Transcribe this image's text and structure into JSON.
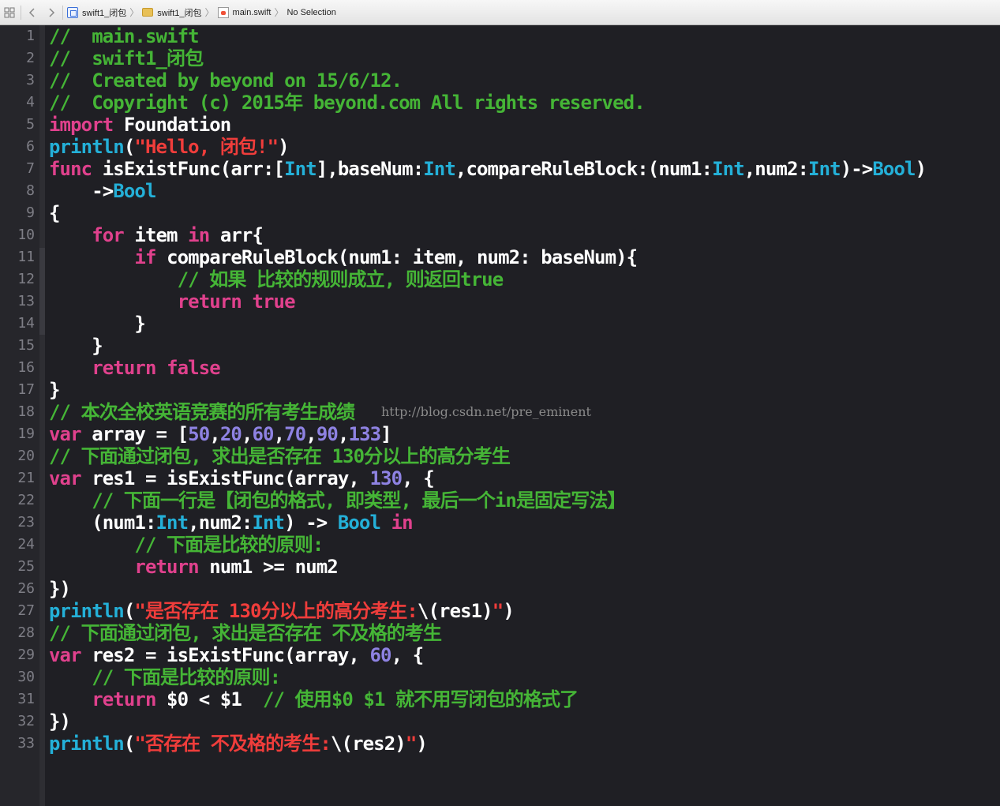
{
  "jumpbar": {
    "crumbs": [
      "swift1_闭包",
      "swift1_闭包",
      "main.swift",
      "No Selection"
    ]
  },
  "colors": {
    "background": "#1f1f24",
    "keyword": "#e0418d",
    "type": "#24b0d8",
    "string": "#f03d3b",
    "comment": "#45b536",
    "number": "#8e82e2",
    "plain": "#ffffff"
  },
  "watermark": "http://blog.csdn.net/pre_eminent",
  "gutter": [
    "1",
    "2",
    "3",
    "4",
    "5",
    "6",
    "7",
    "8",
    "9",
    "10",
    "11",
    "12",
    "13",
    "14",
    "15",
    "16",
    "17",
    "18",
    "19",
    "20",
    "21",
    "22",
    "23",
    "24",
    "25",
    "26",
    "27",
    "28",
    "29",
    "30",
    "31",
    "32",
    "33"
  ],
  "code": [
    [
      [
        "c",
        "//  main.swift"
      ]
    ],
    [
      [
        "c",
        "//  swift1_闭包"
      ]
    ],
    [
      [
        "c",
        "//  Created by beyond on 15/6/12."
      ]
    ],
    [
      [
        "c",
        "//  Copyright (c) 2015年 beyond.com All rights reserved."
      ]
    ],
    [
      [
        "k",
        "import"
      ],
      [
        "p",
        " Foundation"
      ]
    ],
    [
      [
        "t",
        "println"
      ],
      [
        "p",
        "("
      ],
      [
        "s",
        "\"Hello, 闭包!\""
      ],
      [
        "p",
        ")"
      ]
    ],
    [
      [
        "k",
        "func"
      ],
      [
        "p",
        " isExistFunc(arr:["
      ],
      [
        "t",
        "Int"
      ],
      [
        "p",
        "],baseNum:"
      ],
      [
        "t",
        "Int"
      ],
      [
        "p",
        ",compareRuleBlock:(num1:"
      ],
      [
        "t",
        "Int"
      ],
      [
        "p",
        ",num2:"
      ],
      [
        "t",
        "Int"
      ],
      [
        "p",
        ")->"
      ],
      [
        "t",
        "Bool"
      ],
      [
        "p",
        ")"
      ]
    ],
    [
      [
        "p",
        "    ->"
      ],
      [
        "t",
        "Bool"
      ]
    ],
    [
      [
        "p",
        "{"
      ]
    ],
    [
      [
        "p",
        "    "
      ],
      [
        "k",
        "for"
      ],
      [
        "p",
        " item "
      ],
      [
        "k",
        "in"
      ],
      [
        "p",
        " arr{"
      ]
    ],
    [
      [
        "p",
        "        "
      ],
      [
        "k",
        "if"
      ],
      [
        "p",
        " compareRuleBlock(num1: item, num2: baseNum){"
      ]
    ],
    [
      [
        "p",
        "            "
      ],
      [
        "c",
        "// 如果 比较的规则成立, 则返回true"
      ]
    ],
    [
      [
        "p",
        "            "
      ],
      [
        "k",
        "return"
      ],
      [
        "p",
        " "
      ],
      [
        "k",
        "true"
      ]
    ],
    [
      [
        "p",
        "        }"
      ]
    ],
    [
      [
        "p",
        "    }"
      ]
    ],
    [
      [
        "p",
        "    "
      ],
      [
        "k",
        "return"
      ],
      [
        "p",
        " "
      ],
      [
        "k",
        "false"
      ]
    ],
    [
      [
        "p",
        "}"
      ]
    ],
    [
      [
        "c",
        "// 本次全校英语竞赛的所有考生成绩"
      ]
    ],
    [
      [
        "k",
        "var"
      ],
      [
        "p",
        " array = ["
      ],
      [
        "n",
        "50"
      ],
      [
        "p",
        ","
      ],
      [
        "n",
        "20"
      ],
      [
        "p",
        ","
      ],
      [
        "n",
        "60"
      ],
      [
        "p",
        ","
      ],
      [
        "n",
        "70"
      ],
      [
        "p",
        ","
      ],
      [
        "n",
        "90"
      ],
      [
        "p",
        ","
      ],
      [
        "n",
        "133"
      ],
      [
        "p",
        "]"
      ]
    ],
    [
      [
        "c",
        "// 下面通过闭包, 求出是否存在 130分以上的高分考生"
      ]
    ],
    [
      [
        "k",
        "var"
      ],
      [
        "p",
        " res1 = isExistFunc(array, "
      ],
      [
        "n",
        "130"
      ],
      [
        "p",
        ", {"
      ]
    ],
    [
      [
        "p",
        "    "
      ],
      [
        "c",
        "// 下面一行是【闭包的格式, 即类型, 最后一个in是固定写法】"
      ]
    ],
    [
      [
        "p",
        "    (num1:"
      ],
      [
        "t",
        "Int"
      ],
      [
        "p",
        ",num2:"
      ],
      [
        "t",
        "Int"
      ],
      [
        "p",
        ") -> "
      ],
      [
        "t",
        "Bool"
      ],
      [
        "p",
        " "
      ],
      [
        "k",
        "in"
      ]
    ],
    [
      [
        "p",
        "        "
      ],
      [
        "c",
        "// 下面是比较的原则:"
      ]
    ],
    [
      [
        "p",
        "        "
      ],
      [
        "k",
        "return"
      ],
      [
        "p",
        " num1 >= num2"
      ]
    ],
    [
      [
        "p",
        "})"
      ]
    ],
    [
      [
        "t",
        "println"
      ],
      [
        "p",
        "("
      ],
      [
        "s",
        "\"是否存在 130分以上的高分考生:"
      ],
      [
        "p",
        "\\(res1)"
      ],
      [
        "s",
        "\""
      ],
      [
        "p",
        ")"
      ]
    ],
    [
      [
        "c",
        "// 下面通过闭包, 求出是否存在 不及格的考生"
      ]
    ],
    [
      [
        "k",
        "var"
      ],
      [
        "p",
        " res2 = isExistFunc(array, "
      ],
      [
        "n",
        "60"
      ],
      [
        "p",
        ", {"
      ]
    ],
    [
      [
        "p",
        "    "
      ],
      [
        "c",
        "// 下面是比较的原则:"
      ]
    ],
    [
      [
        "p",
        "    "
      ],
      [
        "k",
        "return"
      ],
      [
        "p",
        " $0 < $1  "
      ],
      [
        "c",
        "// 使用$0 $1 就不用写闭包的格式了"
      ]
    ],
    [
      [
        "p",
        "})"
      ]
    ],
    [
      [
        "t",
        "println"
      ],
      [
        "p",
        "("
      ],
      [
        "s",
        "\"否存在 不及格的考生:"
      ],
      [
        "p",
        "\\(res2)"
      ],
      [
        "s",
        "\""
      ],
      [
        "p",
        ")"
      ]
    ]
  ]
}
